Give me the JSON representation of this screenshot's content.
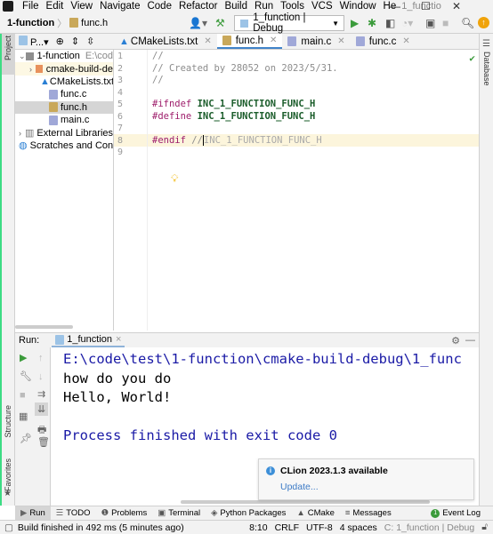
{
  "menubar": {
    "items": [
      "File",
      "Edit",
      "View",
      "Navigate",
      "Code",
      "Refactor",
      "Build",
      "Run",
      "Tools",
      "VCS",
      "Window",
      "He"
    ],
    "title": "1_functio"
  },
  "navbar": {
    "project": "1-function",
    "file": "func.h",
    "config": "1_function | Debug"
  },
  "project_panel": {
    "label": "P...",
    "tree": [
      {
        "label": "1-function",
        "hint": "E:\\cod",
        "type": "folder-gray",
        "indent": 0,
        "arrow": "down"
      },
      {
        "label": "cmake-build-de",
        "type": "folder-orange",
        "indent": 1,
        "arrow": "right"
      },
      {
        "label": "CMakeLists.txt",
        "type": "cmake",
        "indent": 2
      },
      {
        "label": "func.c",
        "type": "c",
        "indent": 2
      },
      {
        "label": "func.h",
        "type": "h",
        "indent": 2,
        "selected": true
      },
      {
        "label": "main.c",
        "type": "c",
        "indent": 2
      },
      {
        "label": "External Libraries",
        "type": "lib",
        "indent": 0,
        "arrow": "right"
      },
      {
        "label": "Scratches and Con",
        "type": "scratch",
        "indent": 0
      }
    ]
  },
  "tabs": [
    {
      "label": "CMakeLists.txt",
      "type": "cmake"
    },
    {
      "label": "func.h",
      "type": "h",
      "active": true
    },
    {
      "label": "main.c",
      "type": "c"
    },
    {
      "label": "func.c",
      "type": "c"
    }
  ],
  "editor": {
    "lines": [
      "1",
      "2",
      "3",
      "4",
      "5",
      "6",
      "7",
      "8",
      "9"
    ],
    "code": {
      "l1": "//",
      "l2": "// Created by 28052 on 2023/5/31.",
      "l3": "//",
      "l5a": "#ifndef",
      "l5b": "INC_1_FUNCTION_FUNC_H",
      "l6a": "#define",
      "l6b": "INC_1_FUNCTION_FUNC_H",
      "l8a": "#endif",
      "l8b": "//",
      "l8c": "INC_1_FUNCTION_FUNC_H"
    }
  },
  "left_strip": {
    "project": "Project",
    "structure": "Structure",
    "favorites": "Favorites"
  },
  "right_strip": {
    "database": "Database"
  },
  "run_panel": {
    "label": "Run:",
    "tab": "1_function",
    "output": [
      "E:\\code\\test\\1-function\\cmake-build-debug\\1_func",
      "how do you do",
      "Hello, World!",
      "",
      "Process finished with exit code 0"
    ]
  },
  "notification": {
    "title": "CLion 2023.1.3 available",
    "link": "Update..."
  },
  "tool_tabs": [
    "Run",
    "TODO",
    "Problems",
    "Terminal",
    "Python Packages",
    "CMake",
    "Messages"
  ],
  "event_log": {
    "label": "Event Log",
    "count": "1"
  },
  "status": {
    "message": "Build finished in 492 ms (5 minutes ago)",
    "position": "8:10",
    "line_sep": "CRLF",
    "encoding": "UTF-8",
    "indent": "4 spaces",
    "context": "C: 1_function | Debug"
  },
  "colors": {
    "accent": "#4083c9",
    "run_green": "#3b9b3b",
    "console_blue": "#1a1aa6"
  }
}
